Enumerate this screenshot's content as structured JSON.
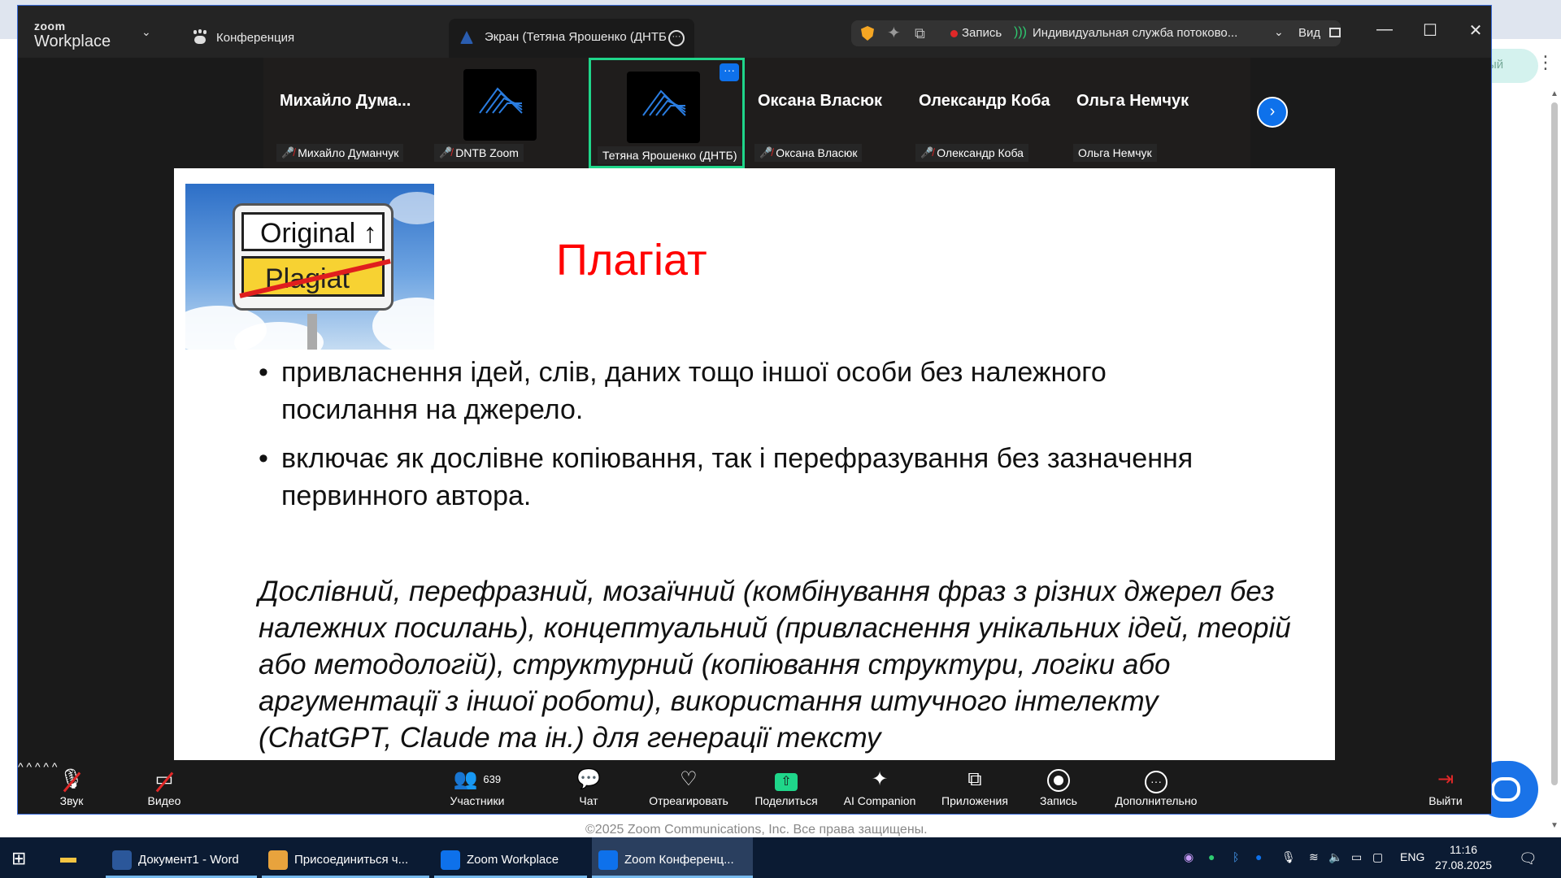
{
  "background": {
    "sidebar_button_text": "ый",
    "footer": "©2025 Zoom Communications, Inc. Все права защищены."
  },
  "titlebar": {
    "logo_small": "zoom",
    "logo_big": "Workplace",
    "conference_label": "Конференция",
    "screen_tab_label": "Экран (Тетяна Ярошенко (ДНТБ",
    "record_label": "Запись",
    "stream_label": "Индивидуальная служба потоково...",
    "view_label": "Вид"
  },
  "participants": [
    {
      "big_name": "Михайло  Дума...",
      "label": "Михайло Думанчук",
      "muted": true,
      "avatar": false,
      "active": false
    },
    {
      "big_name": "",
      "label": "DNTB Zoom",
      "muted": true,
      "avatar": true,
      "active": false
    },
    {
      "big_name": "",
      "label": "Тетяна Ярошенко (ДНТБ)",
      "muted": false,
      "avatar": true,
      "active": true
    },
    {
      "big_name": "Оксана Власюк",
      "label": "Оксана Власюк",
      "muted": true,
      "avatar": false,
      "active": false
    },
    {
      "big_name": "Олександр Коба",
      "label": "Олександр Коба",
      "muted": true,
      "avatar": false,
      "active": false
    },
    {
      "big_name": "Ольга Немчук",
      "label": "Ольга Немчук",
      "muted": false,
      "avatar": false,
      "active": false
    }
  ],
  "slide": {
    "image_top_text": "Original",
    "image_bottom_text": "Plagiat",
    "title": "Плагіат",
    "bullets": [
      "привласнення ідей, слів, даних тощо  іншої особи без належного посилання на джерело.",
      "включає як дослівне копіювання, так і перефразування без зазначення первинного автора."
    ],
    "italic_text": "Дослівний, перефразний, мозаїчний (комбінування фраз з різних джерел без належних посилань), концептуальний (привласнення унікальних ідей, теорій або методологій), структурний (копіювання структури, логіки або аргументації з іншої роботи), використання штучного інтелекту (ChatGPT, Claude та ін.) для генерації тексту"
  },
  "toolbar": {
    "audio": "Звук",
    "video": "Видео",
    "participants": "Участники",
    "participants_count": "639",
    "chat": "Чат",
    "react": "Отреагировать",
    "share": "Поделиться",
    "ai": "AI Companion",
    "apps": "Приложения",
    "record": "Запись",
    "more": "Дополнительно",
    "leave": "Выйти"
  },
  "taskbar": {
    "items": [
      {
        "label": "Документ1 - Word",
        "color": "#2b579a",
        "active": false
      },
      {
        "label": "Присоединиться ч...",
        "color": "#e8a33d",
        "active": false
      },
      {
        "label": "Zoom Workplace",
        "color": "#0e71eb",
        "active": false
      },
      {
        "label": "Zoom Конференц...",
        "color": "#0e71eb",
        "active": true
      }
    ],
    "lang": "ENG",
    "time": "11:16",
    "date": "27.08.2025"
  }
}
